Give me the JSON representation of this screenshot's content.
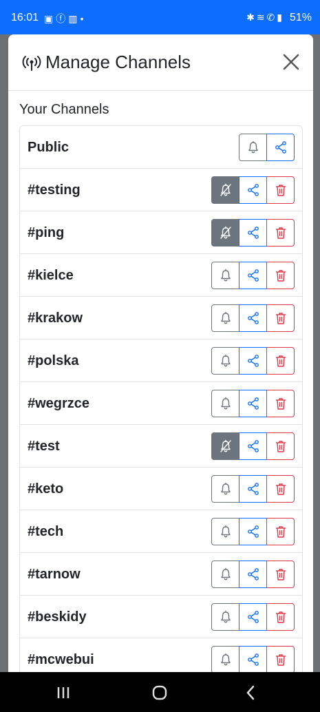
{
  "status_bar": {
    "time": "16:01",
    "battery": "51%",
    "left_icons": [
      "notification-icon",
      "facebook-icon",
      "teams-icon",
      "dot-icon"
    ],
    "right_icons": [
      "bluetooth-icon",
      "wifi-icon",
      "call-icon",
      "signal-icon"
    ]
  },
  "modal": {
    "title": "Manage Channels",
    "section_title": "Your Channels"
  },
  "channels": [
    {
      "name": "Public",
      "muted": false,
      "deletable": false
    },
    {
      "name": "#testing",
      "muted": true,
      "deletable": true
    },
    {
      "name": "#ping",
      "muted": true,
      "deletable": true
    },
    {
      "name": "#kielce",
      "muted": false,
      "deletable": true
    },
    {
      "name": "#krakow",
      "muted": false,
      "deletable": true
    },
    {
      "name": "#polska",
      "muted": false,
      "deletable": true
    },
    {
      "name": "#wegrzce",
      "muted": false,
      "deletable": true
    },
    {
      "name": "#test",
      "muted": true,
      "deletable": true
    },
    {
      "name": "#keto",
      "muted": false,
      "deletable": true
    },
    {
      "name": "#tech",
      "muted": false,
      "deletable": true
    },
    {
      "name": "#tarnow",
      "muted": false,
      "deletable": true
    },
    {
      "name": "#beskidy",
      "muted": false,
      "deletable": true
    },
    {
      "name": "#mcwebui",
      "muted": false,
      "deletable": true
    }
  ],
  "colors": {
    "primary": "#0d6efd",
    "secondary": "#6c757d",
    "danger": "#dc3545"
  },
  "nav_bar": [
    "recents-icon",
    "home-icon",
    "back-icon"
  ]
}
